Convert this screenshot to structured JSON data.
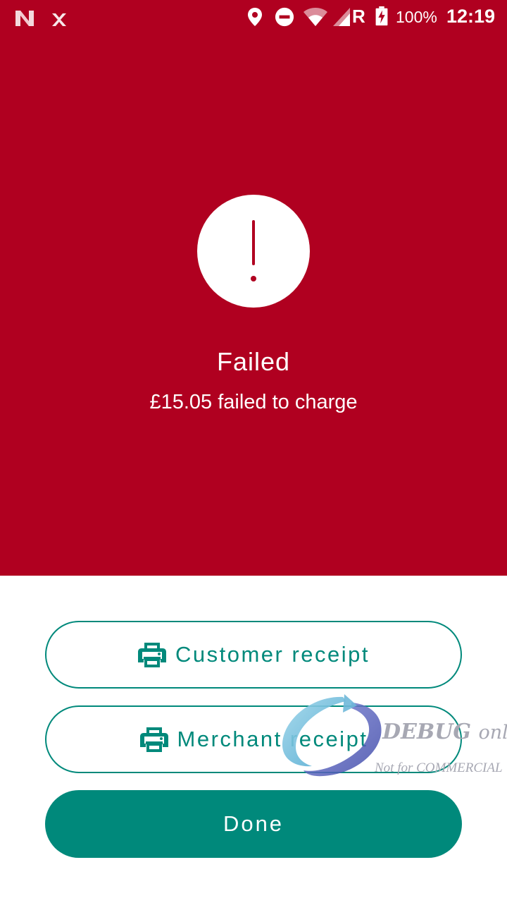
{
  "status_bar": {
    "battery_percent": "100%",
    "time": "12:19",
    "network_label": "R"
  },
  "result": {
    "title": "Failed",
    "message": "£15.05 failed to charge",
    "icon": "exclamation-icon"
  },
  "actions": {
    "customer_receipt": "Customer receipt",
    "merchant_receipt": "Merchant receipt",
    "done": "Done"
  },
  "watermark": {
    "line1_bold": "DEBUG",
    "line1_rest": "only",
    "line2": "Not for COMMERCIAL"
  },
  "colors": {
    "failure_background": "#b00020",
    "accent": "#00897b",
    "surface": "#ffffff"
  }
}
